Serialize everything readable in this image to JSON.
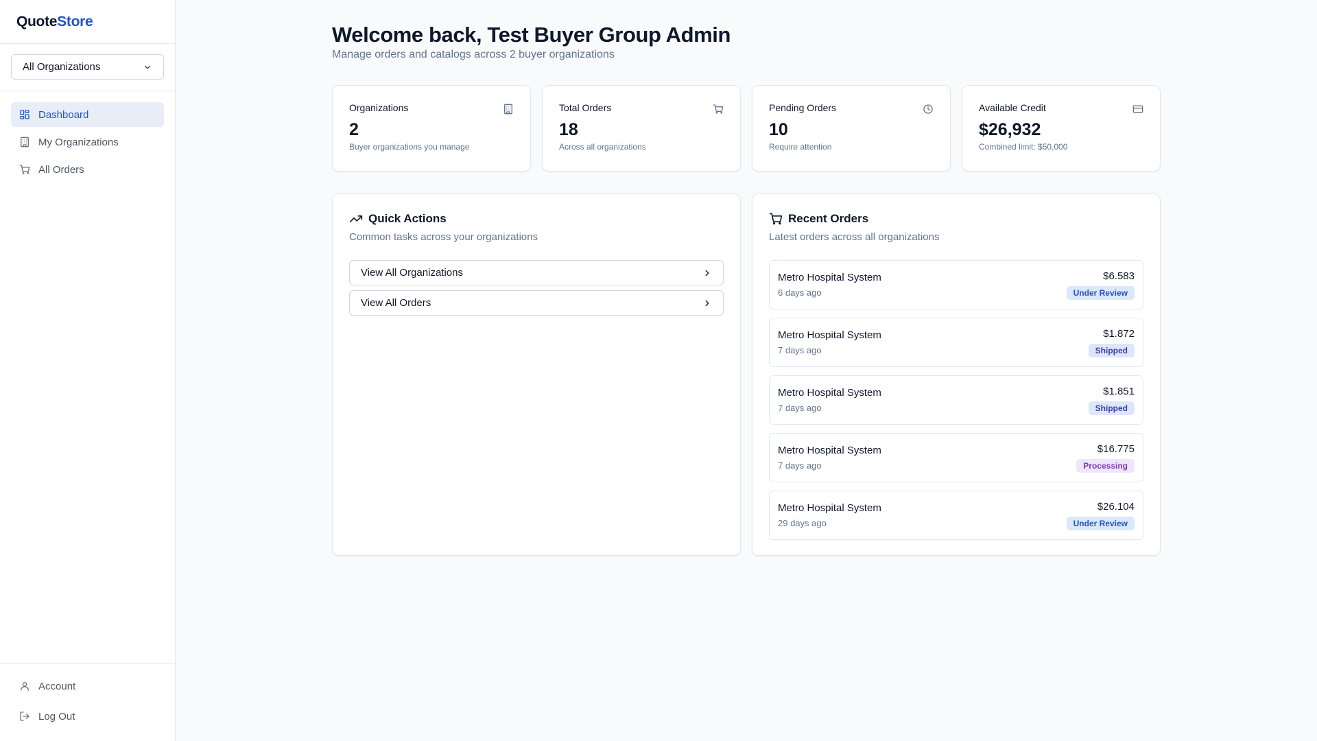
{
  "brand": {
    "part1": "Quote",
    "part2": "Store"
  },
  "org_selector": {
    "value": "All Organizations"
  },
  "nav": {
    "items": [
      {
        "label": "Dashboard",
        "active": true
      },
      {
        "label": "My Organizations",
        "active": false
      },
      {
        "label": "All Orders",
        "active": false
      }
    ],
    "bottom": [
      {
        "label": "Account"
      },
      {
        "label": "Log Out"
      }
    ]
  },
  "header": {
    "title": "Welcome back, Test Buyer Group Admin",
    "subtitle": "Manage orders and catalogs across 2 buyer organizations"
  },
  "stats": [
    {
      "label": "Organizations",
      "value": "2",
      "hint": "Buyer organizations you manage",
      "icon": "building-icon"
    },
    {
      "label": "Total Orders",
      "value": "18",
      "hint": "Across all organizations",
      "icon": "cart-icon"
    },
    {
      "label": "Pending Orders",
      "value": "10",
      "hint": "Require attention",
      "icon": "clock-icon"
    },
    {
      "label": "Available Credit",
      "value": "$26,932",
      "hint": "Combined limit: $50,000",
      "icon": "credit-card-icon"
    }
  ],
  "quick_actions": {
    "title": "Quick Actions",
    "description": "Common tasks across your organizations",
    "items": [
      {
        "label": "View All Organizations"
      },
      {
        "label": "View All Orders"
      }
    ]
  },
  "recent_orders": {
    "title": "Recent Orders",
    "description": "Latest orders across all organizations",
    "items": [
      {
        "name": "Metro Hospital System",
        "time": "6 days ago",
        "amount": "$6.583",
        "status": "Under Review"
      },
      {
        "name": "Metro Hospital System",
        "time": "7 days ago",
        "amount": "$1.872",
        "status": "Shipped"
      },
      {
        "name": "Metro Hospital System",
        "time": "7 days ago",
        "amount": "$1.851",
        "status": "Shipped"
      },
      {
        "name": "Metro Hospital System",
        "time": "7 days ago",
        "amount": "$16.775",
        "status": "Processing"
      },
      {
        "name": "Metro Hospital System",
        "time": "29 days ago",
        "amount": "$26.104",
        "status": "Under Review"
      }
    ]
  },
  "colors": {
    "accent": "#2453c5",
    "background": "#f8fafc",
    "badge_under_review": "#dbe7fb",
    "badge_shipped": "#dde6fb",
    "badge_processing": "#efe6fb"
  }
}
